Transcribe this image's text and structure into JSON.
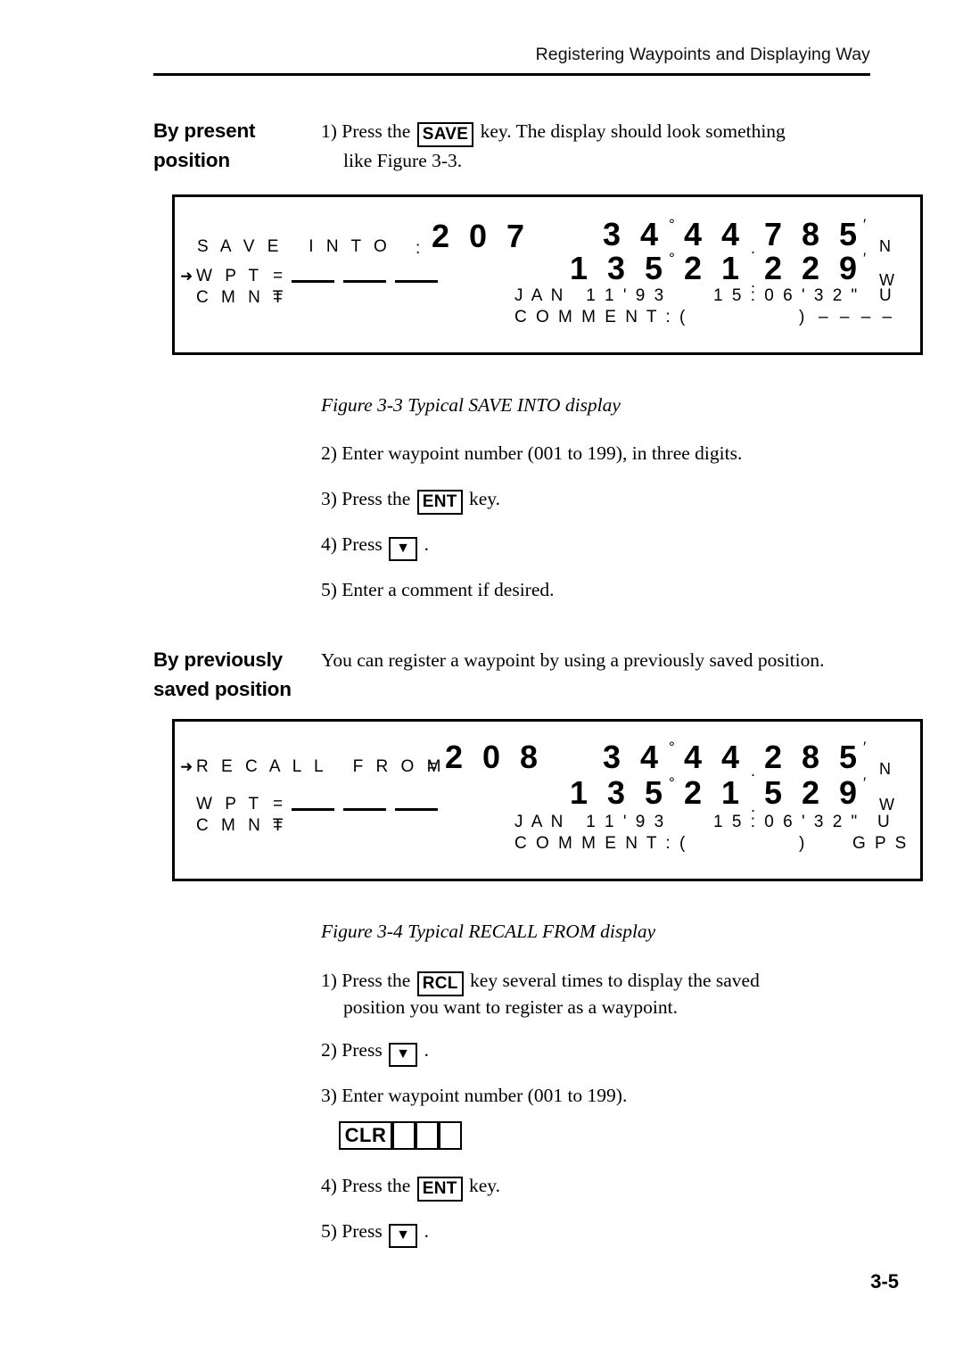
{
  "header": {
    "running_title": "Registering Waypoints and Displaying Way"
  },
  "page_number": "3-5",
  "sections": [
    {
      "heading": "By present\nposition",
      "steps": [
        {
          "num": "1)",
          "pre": "Press  the",
          "key": "SAVE",
          "post": "key.  The  display  should  look  something",
          "cont": "like Figure 3-3."
        },
        {
          "num": "2)",
          "text": "Enter waypoint number (001 to 199), in three digits."
        },
        {
          "num": "3)",
          "pre": "Press the",
          "key": "ENT",
          "post": "key."
        },
        {
          "num": "4)",
          "pre": "Press",
          "key": "▼",
          "post": "."
        },
        {
          "num": "5)",
          "text": "Enter a comment if desired."
        }
      ]
    },
    {
      "heading": "By previously\nsaved position",
      "intro": "You  can  register  a  waypoint  by  using  a  previously  saved position.",
      "steps": [
        {
          "num": "1)",
          "pre": "Press  the",
          "key": "RCL",
          "post": "key  several  times  to  display  the  saved",
          "cont": "position you want to register as a waypoint."
        },
        {
          "num": "2)",
          "pre": "Press",
          "key": "▼",
          "post": "."
        },
        {
          "num": "3)",
          "text": "Enter waypoint number (001 to 199)."
        },
        {
          "num": "4)",
          "pre": "Press the",
          "key": "ENT",
          "post": "key."
        },
        {
          "num": "5)",
          "pre": "Press",
          "key": "▼",
          "post": "."
        }
      ],
      "key_sequence": {
        "clr_label": "CLR",
        "digit_boxes": 3
      }
    }
  ],
  "figures": [
    {
      "id": "figure-3-3",
      "caption": "Figure 3-3 Typical SAVE INTO display",
      "display": {
        "mode_label": "S A V E   I N T O",
        "mode_separator": ":",
        "waypoint_number": "2 0 7",
        "arrow_marker": "➜",
        "wpt_label": "W P T",
        "wpt_equals": "=",
        "wpt_value": "___ ___ ___",
        "cmnt_label": "C M N T",
        "cmnt_equals": "=",
        "lat_value": "3 4",
        "lat_degree": "°",
        "lat_minutes": "4 4",
        "lat_decimal": ".",
        "lat_fraction": "7 8 5",
        "lat_prime": "′",
        "lat_hemisphere": "N",
        "lon_value": "1 3 5",
        "lon_degree": "°",
        "lon_minutes": "2 1",
        "lon_decimal": ".",
        "lon_fraction": "2 2 9",
        "lon_prime": "′",
        "lon_hemisphere": "W",
        "date": "J A N   1 1 ' 9 3",
        "time": "1 5 : 0 6 ' 3 2 \"",
        "time_suffix": "U",
        "comment_label": "C O M M E N T : (",
        "comment_close": ")",
        "source_label": "– – – –"
      }
    },
    {
      "id": "figure-3-4",
      "caption": "Figure 3-4 Typical RECALL FROM display",
      "display": {
        "mode_label": "R E C A L L   F R O M",
        "mode_separator": "=",
        "waypoint_number": "2 0 8",
        "arrow_marker": "➜",
        "wpt_label": "W P T",
        "wpt_equals": "=",
        "wpt_value": "___ ___ ___",
        "cmnt_label": "C M N T",
        "cmnt_equals": "=",
        "lat_value": "3 4",
        "lat_degree": "°",
        "lat_minutes": "4 4",
        "lat_decimal": ".",
        "lat_fraction": "2 8 5",
        "lat_prime": "′",
        "lat_hemisphere": "N",
        "lon_value": "1 3 5",
        "lon_degree": "°",
        "lon_minutes": "2 1",
        "lon_decimal": ".",
        "lon_fraction": "5 2 9",
        "lon_prime": "′",
        "lon_hemisphere": "W",
        "date": "J A N   1 1 ' 9 3",
        "time": "1 5 : 0 6 ' 3 2 \"",
        "time_suffix": "U",
        "comment_label": "C O M M E N T : (",
        "comment_close": ")",
        "source_label": "G P S"
      }
    }
  ]
}
